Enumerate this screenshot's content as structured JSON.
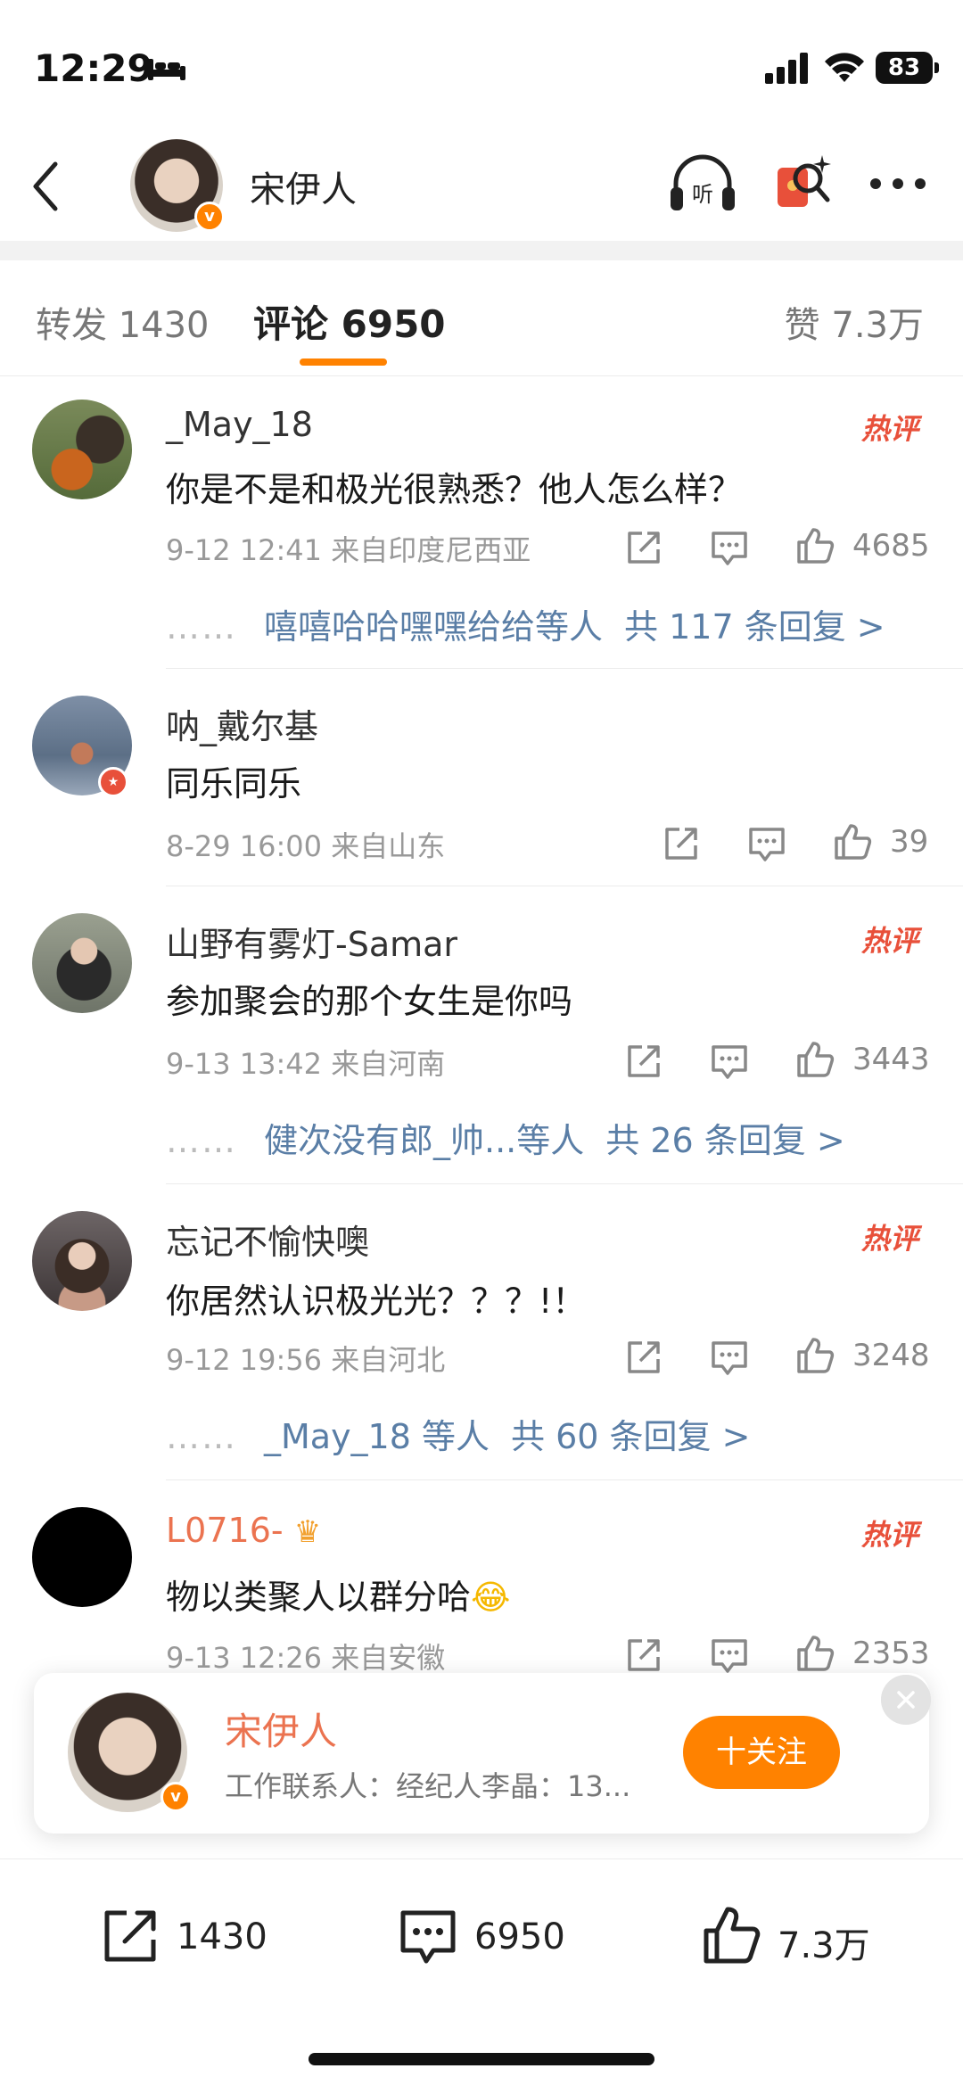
{
  "status_bar": {
    "time": "12:29",
    "battery": "83"
  },
  "header": {
    "name": "宋伊人",
    "verified_badge": "v"
  },
  "tabs": {
    "repost": "转发 1430",
    "comments": "评论 6950",
    "likes": "赞 7.3万"
  },
  "comments": [
    {
      "name": "_May_18",
      "hot": "热评",
      "text": "你是不是和极光很熟悉？他人怎么样？",
      "meta": "9-12 12:41  来自印度尼西亚",
      "likes": "4685",
      "reply_dots": "……",
      "reply_users": "嘻嘻哈哈嘿嘿给给等人",
      "reply_total": "共 117 条回复 >"
    },
    {
      "name": "呐_戴尔基",
      "text": "同乐同乐",
      "meta": "8-29 16:00  来自山东",
      "likes": "39"
    },
    {
      "name": "山野有雾灯-Samar",
      "hot": "热评",
      "text": "参加聚会的那个女生是你吗",
      "meta": "9-13 13:42  来自河南",
      "likes": "3443",
      "reply_dots": "……",
      "reply_users": "健次没有郎_帅...等人",
      "reply_total": "共 26 条回复 >"
    },
    {
      "name": "忘记不愉快噢",
      "hot": "热评",
      "text": "你居然认识极光光？？？!！",
      "meta": "9-12 19:56  来自河北",
      "likes": "3248",
      "reply_dots": "……",
      "reply_users": "_May_18 等人",
      "reply_total": "共 60 条回复 >"
    },
    {
      "name": "L0716-",
      "hot": "热评",
      "text": "物以类聚人以群分哈",
      "emoji": "😂",
      "meta": "9-13 12:26  来自安徽",
      "likes": "2353"
    }
  ],
  "profile_card": {
    "name": "宋伊人",
    "desc": "工作联系人：经纪人李晶：13...",
    "follow_label": "十关注"
  },
  "bottom_bar": {
    "repost": "1430",
    "comment": "6950",
    "like": "7.3万"
  },
  "colors": {
    "accent": "#ff8200",
    "hot": "#e8503a",
    "link": "#5a7ea6"
  }
}
